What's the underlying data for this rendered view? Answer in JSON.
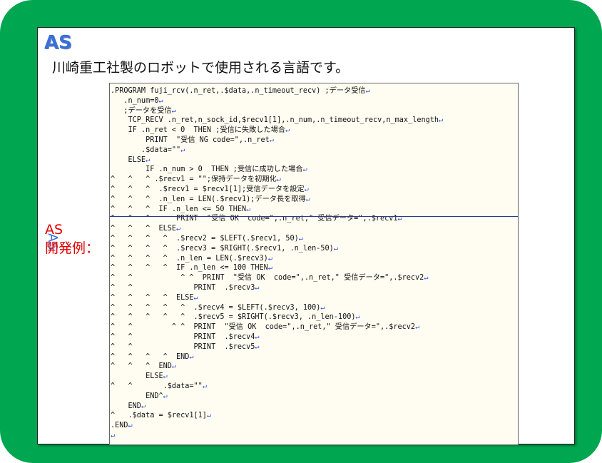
{
  "logo": "AS",
  "description": "川崎重工社製のロボットで使用される言語です。",
  "side_label": "AS",
  "example_label_line1": "AS",
  "example_label_line2": "開発例：",
  "colors": {
    "frame": "#00a650",
    "accent": "#3a6fd8",
    "example": "#e00000"
  },
  "code_lines": [
    ".PROGRAM fuji_rcv(.n_ret,.$data,.n_timeout_recv) ;データ受信↵",
    "   .n_num=0↵",
    "   ;データを受信↵",
    "    TCP_RECV .n_ret,n_sock_id,$recv1[1],.n_num,.n_timeout_recv,n_max_length↵",
    "    IF .n_ret < 0  THEN ;受信に失敗した場合↵",
    "        PRINT  \"受信 NG code=\",.n_ret↵",
    "       .$data=\"\"↵",
    "    ELSE↵",
    "        IF .n_num > 0  THEN ;受信に成功した場合↵",
    "^   ^   ^ .$recv1 = \"\";保持データを初期化↵",
    "^   ^   ^  .$recv1 = $recv1[1];受信データを設定↵",
    "^   ^   ^  .n_len = LEN(.$recv1);データ長を取得↵",
    "^   ^   ^  IF .n_len <= 50 THEN↵",
    "^   ^   ^      PRINT  \"受信 OK  code=\",.n_ret,\" 受信データ=\",.$recv1↵",
    "^   ^   ^  ELSE↵",
    "^   ^   ^   ^  .$recv2 = $LEFT(.$recv1, 50)↵",
    "^   ^   ^   ^  .$recv3 = $RIGHT(.$recv1, .n_len-50)↵",
    "^   ^   ^   ^  .n_len = LEN(.$recv3)↵",
    "^   ^   ^   ^  IF .n_len <= 100 THEN↵",
    "^   ^           ^ ^  PRINT  \"受信 OK  code=\",.n_ret,\" 受信データ=\",.$recv2↵",
    "^   ^              PRINT  .$recv3↵",
    "^   ^   ^   ^  ELSE↵",
    "^   ^   ^   ^   ^  .$recv4 = $LEFT(.$recv3, 100)↵",
    "^   ^   ^   ^   ^  .$recv5 = $RIGHT(.$recv3, .n_len-100)↵",
    "^   ^         ^ ^  PRINT  \"受信 OK  code=\",.n_ret,\" 受信データ=\",.$recv2↵",
    "^   ^              PRINT  .$recv4↵",
    "^   ^              PRINT  .$recv5↵",
    "^   ^   ^   ^  END↵",
    "^   ^   ^  END↵",
    "        ELSE↵",
    "^   ^       .$data=\"\"↵",
    "        END^↵",
    "    END↵",
    "^   .$data = $recv1[1]↵",
    ".END↵",
    "↵"
  ]
}
